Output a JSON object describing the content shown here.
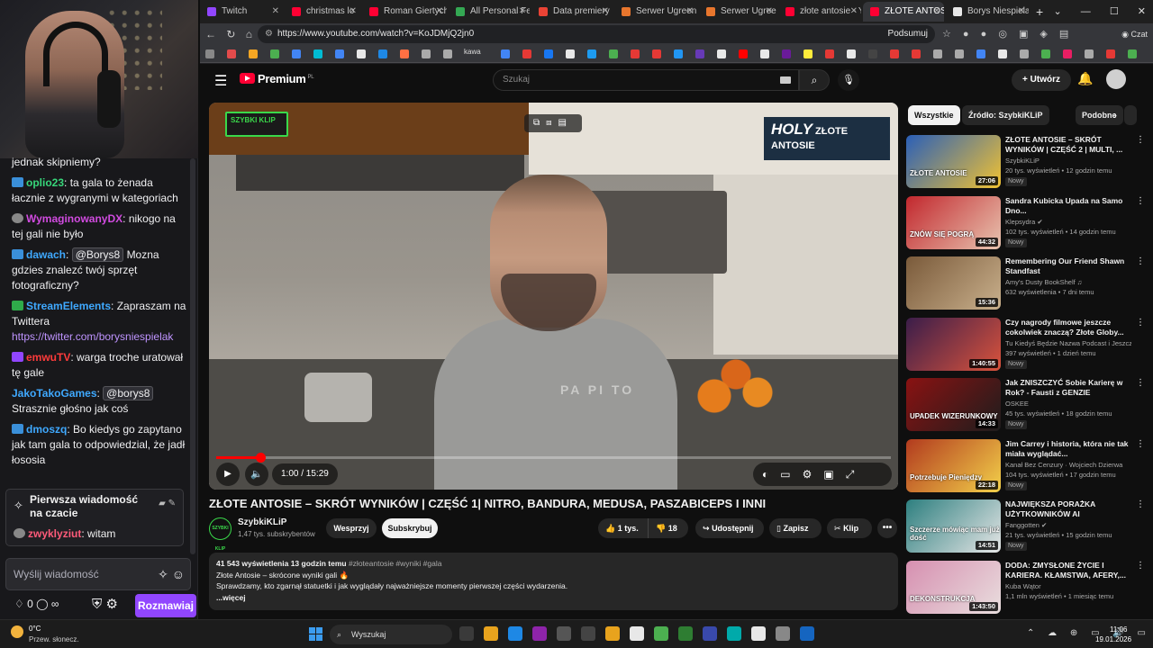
{
  "chat": {
    "messages": [
      {
        "user": "",
        "color": "#efeff1",
        "text": "jednak skipniemy?"
      },
      {
        "user": "oplio23",
        "color": "#37d67a",
        "sep": ":",
        "text": "ta gala to żenada łacznie z wygranymi w kategoriach"
      },
      {
        "user": "WymaginowanyDX",
        "color": "#d14be0",
        "sep": ":",
        "text": "nikogo na tej gali nie było"
      },
      {
        "user": "dawach",
        "color": "#3fa9ff",
        "sep": ":",
        "mention": "@Borys8",
        "text": "Mozna gdzies znalezć twój sprzęt fotograficzny?"
      },
      {
        "user": "StreamElements",
        "color": "#3fa9ff",
        "sep": ":",
        "text": "Zapraszam na Twittera",
        "link": "https://twitter.com/borysniespielak"
      },
      {
        "user": "emwuTV",
        "color": "#ff3b3b",
        "sep": ":",
        "text": "warga troche uratował tę gale"
      },
      {
        "user": "JakoTakoGames",
        "color": "#3fa9ff",
        "sep": ":",
        "mention": "@borys8",
        "text": "Strasznie głośno jak coś"
      },
      {
        "user": "dmoszq",
        "color": "#3fa9ff",
        "sep": ":",
        "text": "Bo kiedys go zapytano jak tam gala to odpowiedzial, że jadł łososia"
      }
    ],
    "pinned": {
      "title": "Pierwsza wiadomość na czacie",
      "user": "zwyklyziut",
      "sep": ":",
      "text": "witam"
    },
    "input_placeholder": "Wyślij wiadomość",
    "points": "0",
    "infinity": "∞",
    "send_label": "Rozmawiaj"
  },
  "browser": {
    "tabs": [
      {
        "label": "Twitch",
        "color": "#9146ff"
      },
      {
        "label": "christmas lo",
        "color": "#ff0033"
      },
      {
        "label": "Roman Giertych",
        "color": "#ff0033"
      },
      {
        "label": "All Personal Fee",
        "color": "#34a853"
      },
      {
        "label": "Data premiery Fo",
        "color": "#ea4335"
      },
      {
        "label": "Serwer Ugreen N",
        "color": "#e8762d"
      },
      {
        "label": "Serwer Ugreen N",
        "color": "#e8762d"
      },
      {
        "label": "złote antosie - Yo",
        "color": "#ff0033"
      },
      {
        "label": "ZŁOTE ANTOSIE",
        "color": "#ff0033"
      },
      {
        "label": "Borys Niespielak",
        "color": "#e8e8e8"
      }
    ],
    "new_tab": "+",
    "window_controls": "⌄ — ☐ ✕",
    "url": "https://www.youtube.com/watch?v=KoJDMjQ2jn0",
    "summarize": "Podsumuj",
    "chat_label": "Czat",
    "bookmark_label": "kawa"
  },
  "youtube": {
    "logo": "Premium",
    "logo_region": "PL",
    "search_placeholder": "Szukaj",
    "create_label": "Utwórz",
    "video": {
      "title": "ZŁOTE ANTOSIE – SKRÓT WYNIKÓW | CZĘŚĆ 1| NITRO, BANDURA, MEDUSA, PASZABICEPS I INNI",
      "time": "1:00 / 15:29",
      "progress": 0.065,
      "logo_left": "SZYBKI KLIP",
      "logo_right_big": "HOLY",
      "logo_right_small": "ZŁOTE ANTOSIE",
      "hoodie_text": "PA PI TO"
    },
    "channel": {
      "name": "SzybkiKLiP",
      "subs": "1,47 tys. subskrybentów",
      "avatar_text": "SZYBKI KLIP"
    },
    "buttons": {
      "support": "Wesprzyj",
      "subscribe": "Subskrybuj",
      "likes": "1 tys.",
      "dislikes": "18",
      "share": "Udostępnij",
      "save": "Zapisz",
      "clip": "Klip",
      "more": "•••"
    },
    "description": {
      "views": "41 543 wyświetlenia",
      "date": "13 godzin temu",
      "tags": "#złoteantosie #wyniki #gala",
      "line1": "Złote Antosie – skrócone wyniki gali 🔥",
      "line2": "Sprawdzamy, kto zgarnął statuetki i jak wyglądały najważniejsze momenty pierwszej części wydarzenia.",
      "more": "...więcej"
    },
    "chips": [
      "Wszystkie",
      "Źródło: SzybkiKLiP",
      "Podobne",
      ""
    ],
    "recommendations": [
      {
        "title": "ZŁOTE ANTOSIE – SKRÓT WYNIKÓW | CZĘŚĆ 2 | MULTI, ...",
        "channel": "SzybkiKLiP",
        "meta": "20 tys. wyświetleń • 12 godzin temu",
        "badge": "Nowy",
        "duration": "27:06",
        "thumb_text": "ZŁOTE ANTOSIE",
        "c1": "#2a5fb8",
        "c2": "#f1c232"
      },
      {
        "title": "Sandra Kubicka Upada na Samo Dno...",
        "channel": "Klepsydra ✔",
        "meta": "102 tys. wyświetleń • 14 godzin temu",
        "badge": "Nowy",
        "duration": "44:32",
        "thumb_text": "ZNÓW SIĘ POGRĄ",
        "c1": "#c2272d",
        "c2": "#e8c4b0"
      },
      {
        "title": "Remembering Our Friend Shawn Standfast",
        "channel": "Amy's Dusty BookShelf ♫",
        "meta": "632 wyświetlenia • 7 dni temu",
        "badge": "",
        "duration": "15:36",
        "thumb_text": "",
        "c1": "#7a5a3a",
        "c2": "#c9b08c"
      },
      {
        "title": "Czy nagrody filmowe jeszcze cokolwiek znaczą? Złote Globy...",
        "channel": "Tu Kiedyś Będzie Nazwa Podcast i Jeszcz...",
        "meta": "397 wyświetleń • 1 dzień temu",
        "badge": "Nowy",
        "duration": "1:40:55",
        "thumb_text": "",
        "c1": "#3a1d4a",
        "c2": "#d9533c"
      },
      {
        "title": "Jak ZNISZCZYĆ Sobie Karierę w Rok? - Fausti z GENZIE",
        "channel": "OSKEE",
        "meta": "45 tys. wyświetleń • 18 godzin temu",
        "badge": "Nowy",
        "duration": "14:33",
        "thumb_text": "UPADEK WIZERUNKOWY",
        "c1": "#8a1212",
        "c2": "#1d1d1d"
      },
      {
        "title": "Jim Carrey i historia, która nie tak miała wyglądać...",
        "channel": "Kanał Bez Cenzury · Wojciech Dzierwa",
        "meta": "104 tys. wyświetleń • 17 godzin temu",
        "badge": "Nowy",
        "duration": "22:18",
        "thumb_text": "Potrzebuje Pieniędzy",
        "c1": "#b23a1e",
        "c2": "#f2d04a"
      },
      {
        "title": "NAJWIĘKSZA PORAŻKA UŻYTKOWNIKÓW AI",
        "channel": "Fanggotten ✔",
        "meta": "21 tys. wyświetleń • 15 godzin temu",
        "badge": "Nowy",
        "duration": "14:51",
        "thumb_text": "Szczerze mówiąc mam już dość",
        "c1": "#2d7f7f",
        "c2": "#e6e6e6"
      },
      {
        "title": "DODA: ZMYSŁONE ŻYCIE I KARIERA. KŁAMSTWA, AFERY,...",
        "channel": "Kuba Wątor",
        "meta": "1,1 mln wyświetleń • 1 miesiąc temu",
        "badge": "",
        "duration": "1:43:50",
        "thumb_text": "DEKONSTRUKCJA",
        "c1": "#d68fb0",
        "c2": "#e9dede"
      }
    ]
  },
  "taskbar": {
    "temp": "0°C",
    "weather": "Przew. słonecz.",
    "search": "Wyszukaj",
    "time": "11:06",
    "date": "19.01.2026",
    "tray": "⌃ ☁ ⊕ ▭ 🔊 ▭"
  },
  "colors": {
    "accent_red": "#ff0033",
    "twitch_purple": "#9146ff"
  }
}
